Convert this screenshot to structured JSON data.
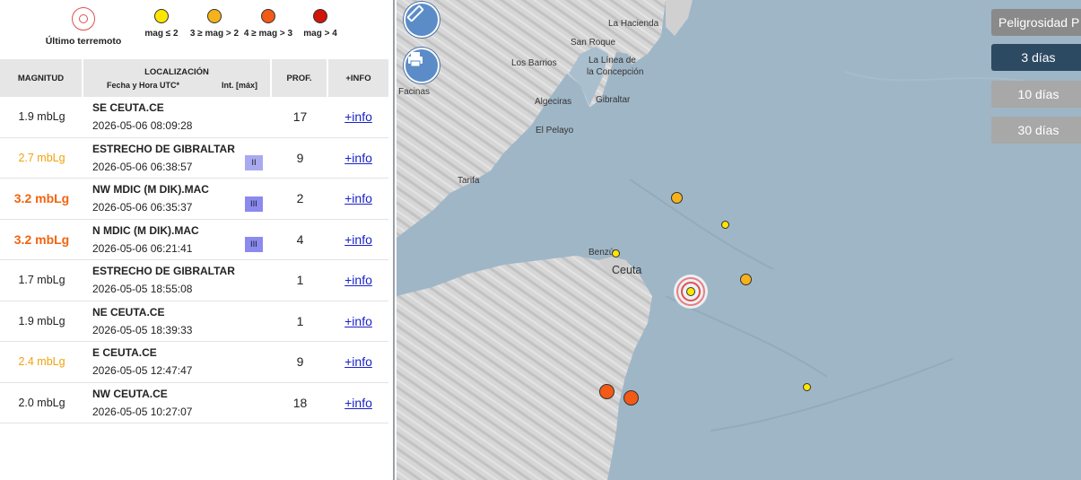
{
  "legend": {
    "last_quake": "Último terremoto",
    "m1": "mag ≤ 2",
    "m2": "3 ≥ mag > 2",
    "m3": "4 ≥ mag > 3",
    "m4": "mag > 4"
  },
  "table": {
    "headers": {
      "magnitude": "MAGNITUD",
      "location": "LOCALIZACIÓN",
      "datetime": "Fecha y Hora UTC*",
      "intensity": "Int. [máx]",
      "depth": "PROF.",
      "info": "+INFO"
    },
    "rows": [
      {
        "mag": "1.9 mbLg",
        "place": "SE CEUTA.CE",
        "dt": "2026-05-06 08:09:28",
        "int": "",
        "depth": "17",
        "info": "+info"
      },
      {
        "mag": "2.7 mbLg",
        "place": "ESTRECHO DE GIBRALTAR",
        "dt": "2026-05-06 06:38:57",
        "int": "II",
        "depth": "9",
        "info": "+info"
      },
      {
        "mag": "3.2 mbLg",
        "place": "NW MDIC (M DIK).MAC",
        "dt": "2026-05-06 06:35:37",
        "int": "III",
        "depth": "2",
        "info": "+info"
      },
      {
        "mag": "3.2 mbLg",
        "place": "N MDIC (M DIK).MAC",
        "dt": "2026-05-06 06:21:41",
        "int": "III",
        "depth": "4",
        "info": "+info"
      },
      {
        "mag": "1.7 mbLg",
        "place": "ESTRECHO DE GIBRALTAR",
        "dt": "2026-05-05 18:55:08",
        "int": "",
        "depth": "1",
        "info": "+info"
      },
      {
        "mag": "1.9 mbLg",
        "place": "NE CEUTA.CE",
        "dt": "2026-05-05 18:39:33",
        "int": "",
        "depth": "1",
        "info": "+info"
      },
      {
        "mag": "2.4 mbLg",
        "place": "E CEUTA.CE",
        "dt": "2026-05-05 12:47:47",
        "int": "",
        "depth": "9",
        "info": "+info"
      },
      {
        "mag": "2.0 mbLg",
        "place": "NW CEUTA.CE",
        "dt": "2026-05-05 10:27:07",
        "int": "",
        "depth": "18",
        "info": "+info"
      }
    ]
  },
  "map": {
    "places": {
      "la_hacienda": "La Hacienda",
      "san_roque": "San Roque",
      "los_barrios": "Los Barrios",
      "la_linea": "La Línea de",
      "la_concepcion": "la Concepción",
      "gibraltar": "Gibraltar",
      "algeciras": "Algeciras",
      "facinas": "Facinas",
      "el_pelayo": "El Pelayo",
      "tarifa": "Tarifa",
      "benzu": "Benzú",
      "ceuta": "Ceuta"
    },
    "buttons": {
      "peligrosidad": "Peligrosidad P",
      "d3": "3 días",
      "d10": "10 días",
      "d30": "30 días"
    },
    "colors": {
      "sea": "#9fb6c6",
      "land": "#d5d5d5",
      "active": "#2d4a63"
    }
  }
}
